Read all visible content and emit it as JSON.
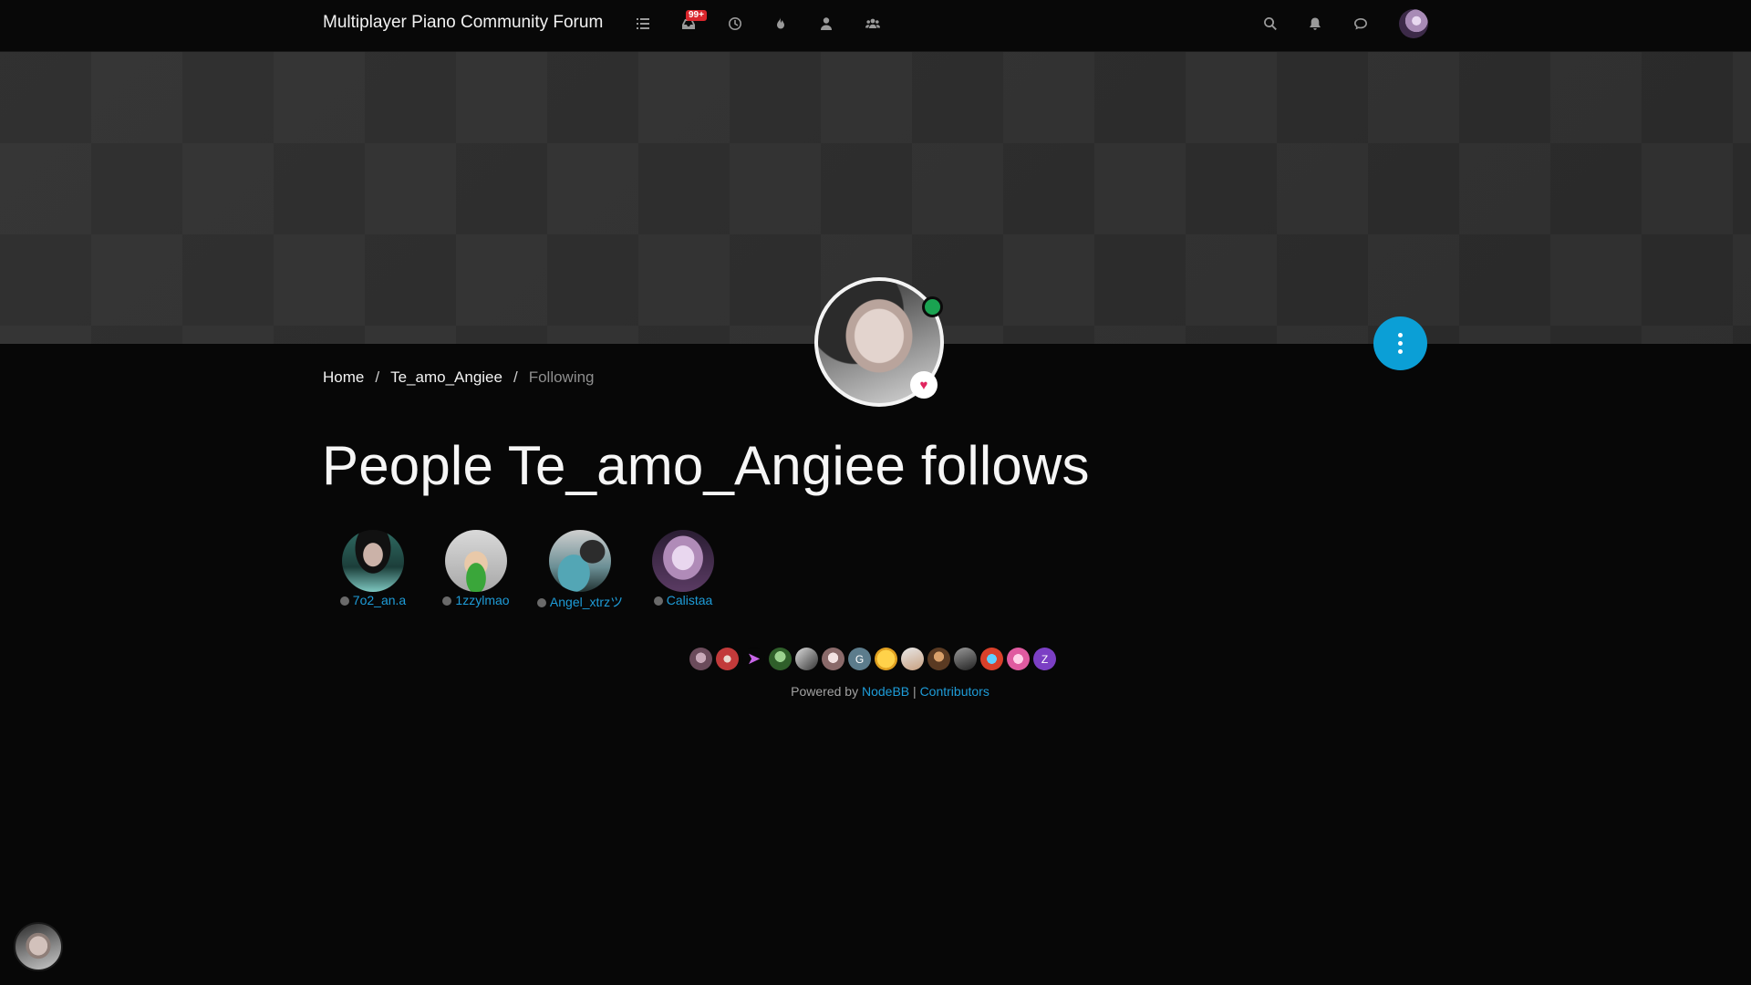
{
  "navbar": {
    "brand": "Multiplayer Piano Community Forum",
    "unread_badge": "99+",
    "icons": [
      "categories-icon",
      "unread-icon",
      "recent-icon",
      "popular-icon",
      "users-icon",
      "groups-icon"
    ],
    "right_icons": [
      "search-icon",
      "notifications-icon",
      "chat-icon"
    ]
  },
  "breadcrumb": {
    "home": "Home",
    "user": "Te_amo_Angiee",
    "current": "Following"
  },
  "page": {
    "title": "People Te_amo_Angiee follows"
  },
  "following": [
    {
      "name": "7o2_an.a"
    },
    {
      "name": "1zzylmao"
    },
    {
      "name": "Angel_xtrzツ"
    },
    {
      "name": "Calistaa"
    }
  ],
  "footer": {
    "online_letters": [
      "G",
      "Z"
    ],
    "powered_prefix": "Powered by",
    "nodebb": "NodeBB",
    "separator": "|",
    "contributors": "Contributors"
  },
  "colors": {
    "accent": "#1e9cd8",
    "fab": "#0b9fd6",
    "online": "#1aa351",
    "badge": "#d9262c"
  }
}
